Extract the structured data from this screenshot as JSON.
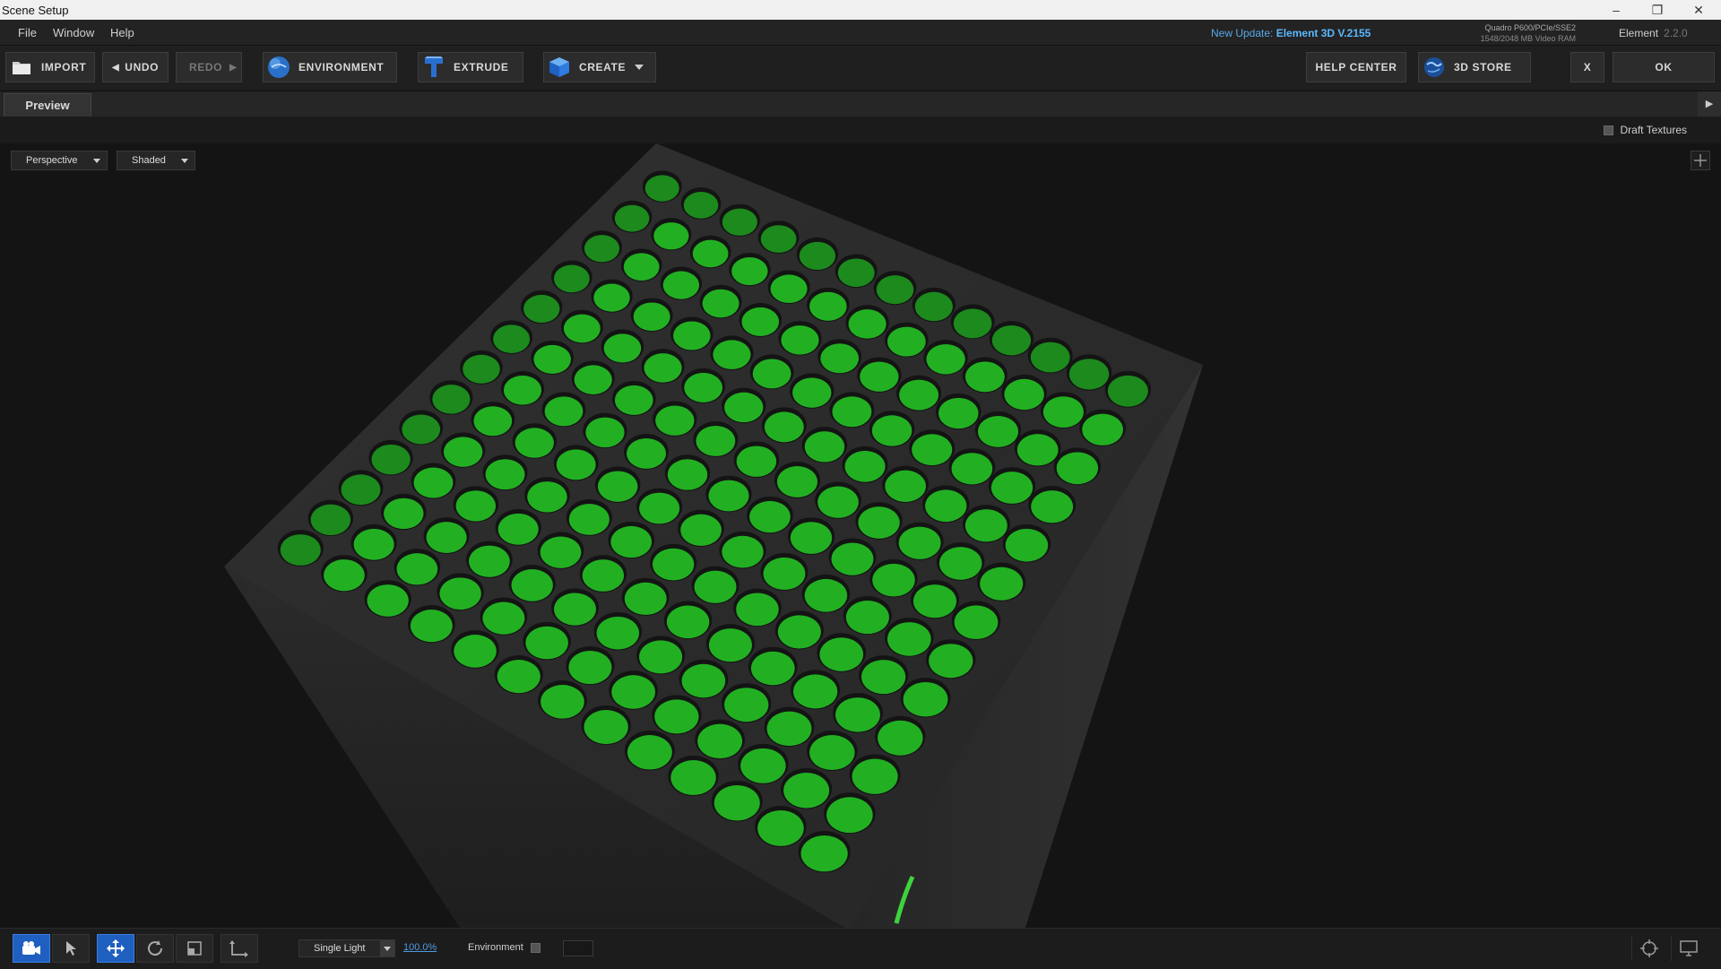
{
  "window": {
    "title": "Scene Setup",
    "minimize": "–",
    "restore": "❐",
    "close": "✕"
  },
  "menu": [
    "File",
    "Window",
    "Help"
  ],
  "update": {
    "prefix": "New Update:",
    "version": "Element 3D V.2155"
  },
  "gpu": {
    "name": "Quadro P600/PCIe/SSE2",
    "vram": "1548/2048 MB Video RAM"
  },
  "product": {
    "name": "Element",
    "version": "2.2.0"
  },
  "toolbar": {
    "import": "IMPORT",
    "undo": "UNDO",
    "redo": "REDO",
    "environment": "ENVIRONMENT",
    "extrude": "EXTRUDE",
    "create": "CREATE",
    "help_center": "HELP CENTER",
    "store": "3D STORE",
    "close": "X",
    "ok": "OK"
  },
  "tabs": {
    "preview": "Preview"
  },
  "options": {
    "draft_textures": "Draft Textures",
    "draft_textures_checked": false
  },
  "viewport": {
    "camera": "Perspective",
    "shading": "Shaded"
  },
  "colors": {
    "accent_blue": "#1f5fbf",
    "update_blue": "#5ab8ff",
    "vent_green": "#22b022",
    "body_dark": "#2a2a2a"
  },
  "bottom": {
    "tools": [
      "camera-icon",
      "select-arrow-icon",
      "move-icon",
      "rotate-icon",
      "scale-icon",
      "axis-icon"
    ],
    "active_tool": "move-icon",
    "light": "Single Light",
    "intensity": "100.0%",
    "environment_label": "Environment",
    "environment_checked": false
  }
}
